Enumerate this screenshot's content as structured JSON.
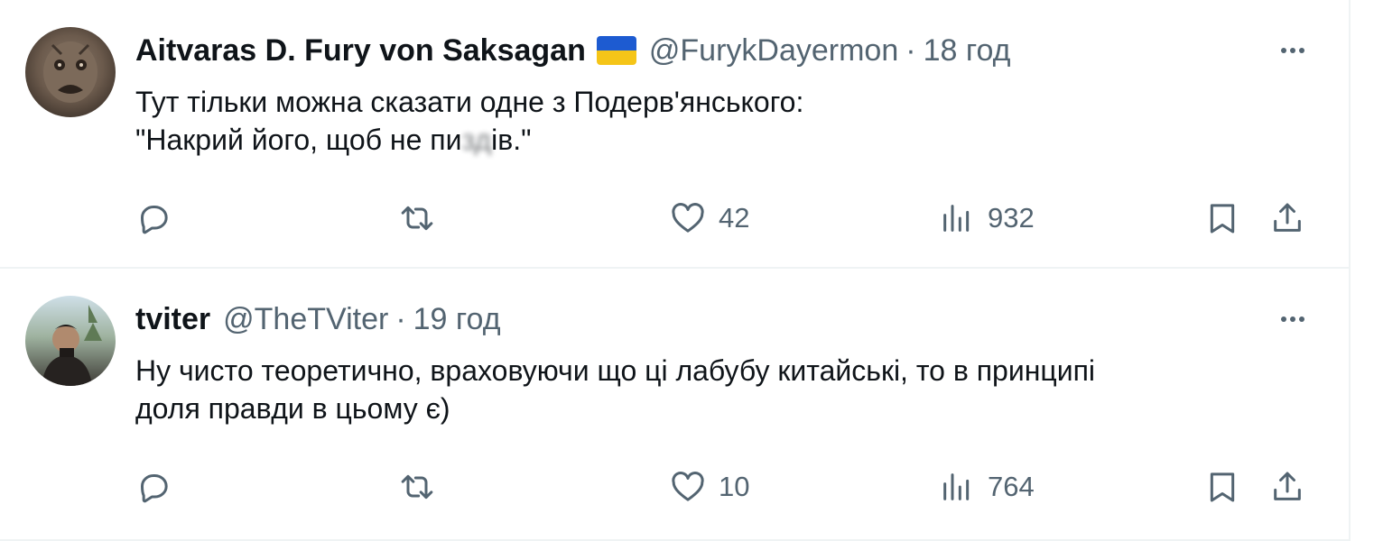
{
  "tweets": [
    {
      "author": "Aitvaras D. Fury von Saksagan",
      "handle": "@FurykDayermon",
      "separator": "·",
      "time": "18 год",
      "text_line1": "Тут тільки можна сказати одне з Подерв'янського:",
      "text_line2_a": "\"Накрий його, щоб не пи",
      "text_line2_censored": "зд",
      "text_line2_b": "ів.\"",
      "stats": {
        "replies": "",
        "reposts": "",
        "likes": "42",
        "views": "932"
      }
    },
    {
      "author": "tviter",
      "handle": "@TheTViter",
      "separator": "·",
      "time": "19 год",
      "text_line1": "Ну чисто теоретично, враховуючи що ці лабубу китайські, то в принципі",
      "text_line2": "доля правди в цьому є)",
      "stats": {
        "replies": "",
        "reposts": "",
        "likes": "10",
        "views": "764"
      }
    }
  ],
  "icons": [
    "avatar",
    "ukraine-flag-icon",
    "more-icon",
    "reply-icon",
    "repost-icon",
    "like-icon",
    "views-icon",
    "bookmark-icon",
    "share-icon"
  ],
  "colors": {
    "text": "#0f1419",
    "muted": "#536471",
    "divider": "#eff3f4",
    "flag_blue": "#1d5bd1",
    "flag_yellow": "#f5c518"
  }
}
